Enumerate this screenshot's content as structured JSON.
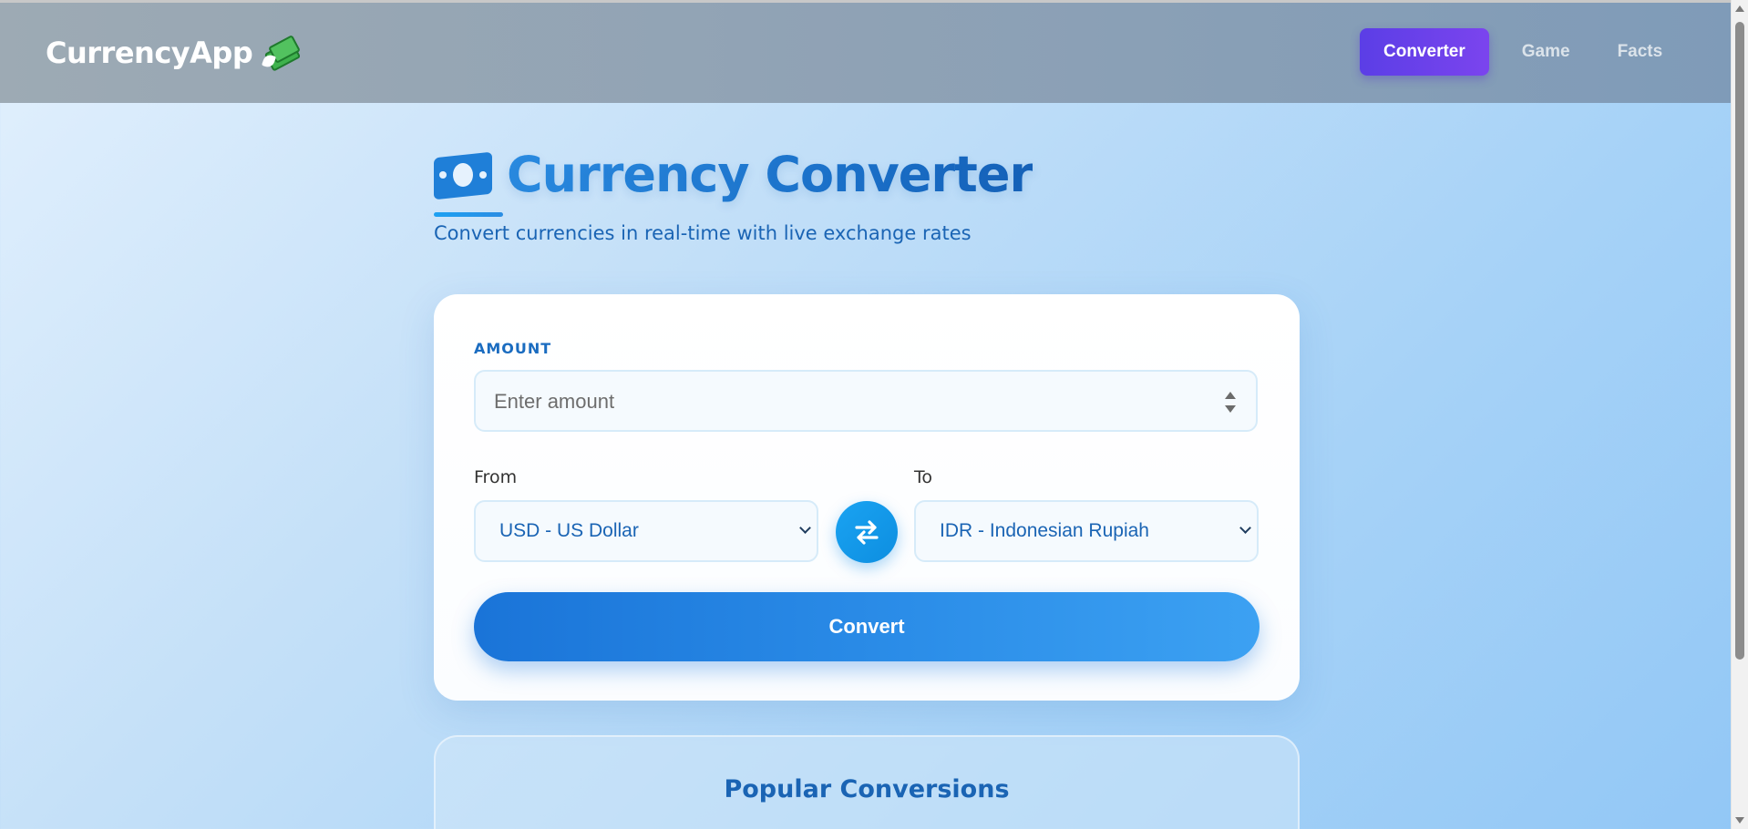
{
  "navbar": {
    "brand": "CurrencyApp",
    "brand_icon": "money-with-wings-icon",
    "items": [
      {
        "label": "Converter",
        "active": true
      },
      {
        "label": "Game",
        "active": false
      },
      {
        "label": "Facts",
        "active": false
      }
    ],
    "active_color": "#6a41eb"
  },
  "header": {
    "title_icon": "banknote-icon",
    "title": "Currency Converter",
    "subtitle": "Convert currencies in real-time with live exchange rates"
  },
  "converter": {
    "amount_label": "AMOUNT",
    "amount_placeholder": "Enter amount",
    "from_label": "From",
    "from_value": "USD - US Dollar",
    "to_label": "To",
    "to_value": "IDR - Indonesian Rupiah",
    "swap_icon": "swap-arrows-icon",
    "convert_label": "Convert",
    "accent_color": "#1f83e0"
  },
  "popular": {
    "title": "Popular Conversions"
  }
}
